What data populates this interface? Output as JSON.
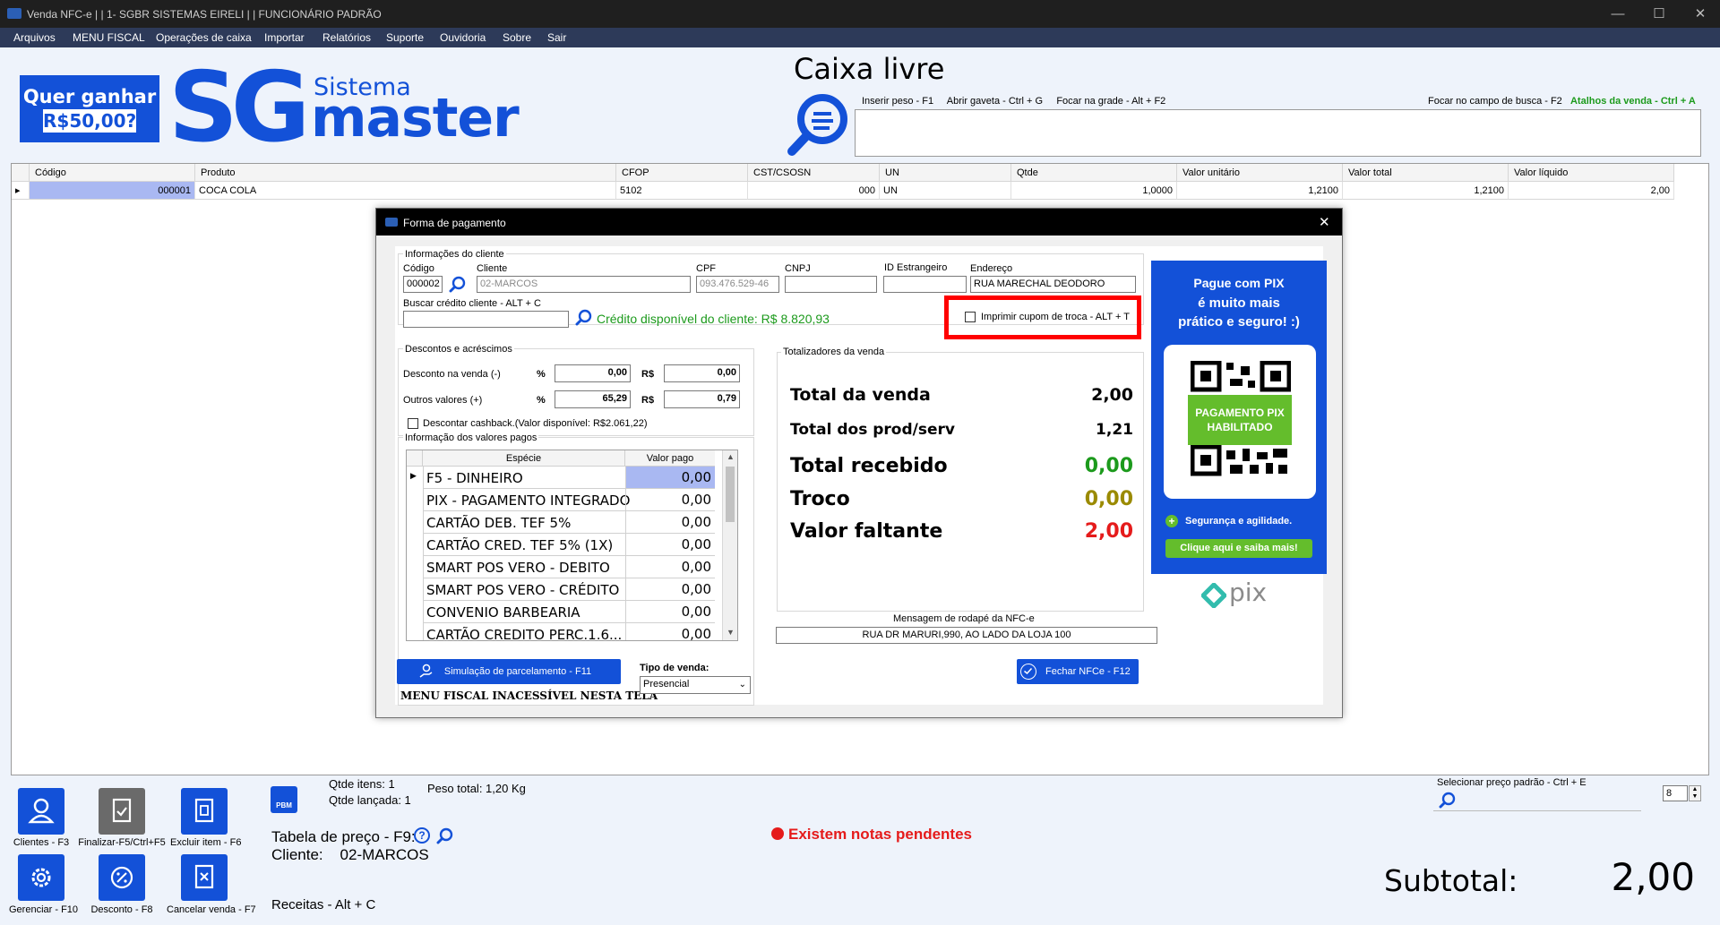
{
  "window": {
    "title": "Venda NFC-e | | 1- SGBR SISTEMAS EIRELI | | FUNCIONÁRIO PADRÃO"
  },
  "menu": [
    "Arquivos",
    "MENU FISCAL",
    "Operações de caixa",
    "Importar",
    "Relatórios",
    "Suporte",
    "Ouvidoria",
    "Sobre",
    "Sair"
  ],
  "logo": {
    "promo_line1": "Quer ganhar",
    "promo_line2": "R$50,00?",
    "sg": "SG",
    "sistema": "Sistema",
    "master": "master"
  },
  "header": {
    "status": "Caixa livre",
    "shortcuts": "Inserir peso - F1     Abrir gaveta - Ctrl + G     Focar na grade - Alt + F2",
    "focus_search": "Focar no campo de busca - F2",
    "sale_shortcuts": "Atalhos da venda - Ctrl + A"
  },
  "grid": {
    "columns": [
      "Código",
      "Produto",
      "CFOP",
      "CST/CSOSN",
      "UN",
      "Qtde",
      "Valor unitário",
      "Valor total",
      "Valor líquido"
    ],
    "rows": [
      {
        "codigo": "000001",
        "produto": "COCA COLA",
        "cfop": "5102",
        "cst": "000",
        "un": "UN",
        "qtde": "1,0000",
        "valor_unitario": "1,2100",
        "valor_total": "1,2100",
        "valor_liquido": "2,00"
      }
    ]
  },
  "dialog": {
    "title": "Forma de pagamento",
    "client_group": "Informações do cliente",
    "labels": {
      "codigo": "Código",
      "cliente": "Cliente",
      "cpf": "CPF",
      "cnpj": "CNPJ",
      "id_estrangeiro": "ID Estrangeiro",
      "endereco": "Endereço",
      "buscar_credito": "Buscar crédito cliente - ALT + C"
    },
    "values": {
      "codigo": "000002",
      "cliente": "02-MARCOS",
      "cpf": "093.476.529-46",
      "cnpj": "",
      "id_estrangeiro": "",
      "endereco": "RUA MARECHAL DEODORO",
      "buscar_credito": ""
    },
    "credit_text": "Crédito disponível do cliente: R$ 8.820,93",
    "imprimir_cupom": "Imprimir cupom de troca - ALT + T",
    "discounts_group": "Descontos e acréscimos",
    "desconto_label": "Desconto na venda (-)",
    "outros_label": "Outros valores (+)",
    "pct": "%",
    "rs": "R$",
    "desconto_pct": "0,00",
    "desconto_rs": "0,00",
    "outros_pct": "65,29",
    "outros_rs": "0,79",
    "cashback": "Descontar cashback.(Valor disponível: R$2.061,22)",
    "pagos_group": "Informação dos valores pagos",
    "pagos_cols": [
      "Espécie",
      "Valor pago"
    ],
    "pagos": [
      {
        "especie": "F5 - DINHEIRO",
        "valor": "0,00"
      },
      {
        "especie": "PIX - PAGAMENTO INTEGRADO",
        "valor": "0,00"
      },
      {
        "especie": "CARTÃO DEB.  TEF 5%",
        "valor": "0,00"
      },
      {
        "especie": "CARTÃO CRED. TEF 5% (1X)",
        "valor": "0,00"
      },
      {
        "especie": "SMART POS VERO - DEBITO",
        "valor": "0,00"
      },
      {
        "especie": "SMART POS VERO - CRÉDITO",
        "valor": "0,00"
      },
      {
        "especie": "CONVENIO BARBEARIA",
        "valor": "0,00"
      },
      {
        "especie": "CARTÃO CREDITO PERC.1.6...",
        "valor": "0,00"
      }
    ],
    "totals_group": "Totalizadores da venda",
    "totals": {
      "total_venda_label": "Total da venda",
      "total_venda": "2,00",
      "total_prod_label": "Total dos prod/serv",
      "total_prod": "1,21",
      "total_recebido_label": "Total recebido",
      "total_recebido": "0,00",
      "troco_label": "Troco",
      "troco": "0,00",
      "faltante_label": "Valor faltante",
      "faltante": "2,00"
    },
    "rodape_label": "Mensagem de rodapé da NFC-e",
    "rodape_value": "RUA  DR MARURI,990, AO LADO DA LOJA 100",
    "simulacao_btn": "Simulação de parcelamento - F11",
    "menu_fiscal_note": "MENU FISCAL INACESSÍVEL NESTA TELA",
    "tipo_venda_label": "Tipo de venda:",
    "tipo_venda_value": "Presencial",
    "fechar_btn": "Fechar NFCe - F12",
    "pix": {
      "line1": "Pague com PIX",
      "line2": "é muito mais",
      "line3": "prático e seguro! :)",
      "badge": "PAGAMENTO PIX HABILITADO",
      "security": "Segurança e agilidade.",
      "cta": "Clique aqui e saiba mais!",
      "brand": "pix"
    }
  },
  "bottom": {
    "buttons": [
      {
        "label": "Clientes - F3"
      },
      {
        "label": "Finalizar-F5/Ctrl+F5"
      },
      {
        "label": "Excluir item - F6"
      },
      {
        "label": "Gerenciar - F10"
      },
      {
        "label": "Desconto - F8"
      },
      {
        "label": "Cancelar venda - F7"
      }
    ],
    "pbm": "PBM",
    "qtde_itens": "Qtde itens: 1",
    "qtde_lancada": "Qtde lançada: 1",
    "peso_total": "Peso total: 1,20 Kg",
    "tabela_preco": "Tabela de preço - F9:",
    "cliente": "Cliente:    02-MARCOS",
    "receitas": "Receitas - Alt + C",
    "pendentes": "Existem notas pendentes",
    "selecionar_preco": "Selecionar preço padrão - Ctrl + E",
    "spin_value": "8",
    "subtotal_label": "Subtotal:",
    "subtotal_value": "2,00"
  },
  "colors": {
    "brand_blue": "#1351d8",
    "green": "#1c9a1c",
    "red": "#e51b1b",
    "olive": "#9a8a00",
    "highlight_red": "#ff0000"
  }
}
